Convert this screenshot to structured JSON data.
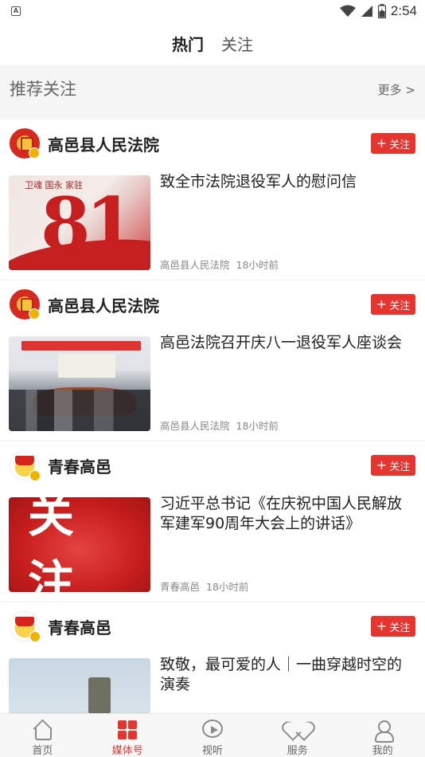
{
  "status_bar": {
    "time": "2:54",
    "notification_badge": "A"
  },
  "top_tabs": [
    {
      "label": "热门",
      "active": true
    },
    {
      "label": "关注",
      "active": false
    }
  ],
  "recommend": {
    "title": "推荐关注",
    "more": "更多 >"
  },
  "follow_label": "关注",
  "feed": [
    {
      "channel": "高邑县人民法院",
      "avatar": "court-emblem",
      "title": "致全市法院退役军人的慰问信",
      "source": "高邑县人民法院",
      "time": "18小时前",
      "thumb": "army-day-81",
      "thumb_text": "卫魂 国永 家驻"
    },
    {
      "channel": "高邑县人民法院",
      "avatar": "court-emblem",
      "title": "高邑法院召开庆八一退役军人座谈会",
      "source": "高邑县人民法院",
      "time": "18小时前",
      "thumb": "meeting-photo"
    },
    {
      "channel": "青春高邑",
      "avatar": "youth-league-emblem",
      "title": "习近平总书记《在庆祝中国人民解放军建军90周年大会上的讲话》",
      "source": "青春高邑",
      "time": "18小时前",
      "thumb": "guanzhu-banner",
      "thumb_text": "关注"
    },
    {
      "channel": "青春高邑",
      "avatar": "youth-league-emblem",
      "title": "致敬，最可爱的人｜一曲穿越时空的演奏",
      "thumb": "outdoor-photo"
    }
  ],
  "bottom_nav": [
    {
      "label": "首页",
      "icon": "home-icon",
      "active": false
    },
    {
      "label": "媒体号",
      "icon": "media-grid-icon",
      "active": true
    },
    {
      "label": "视听",
      "icon": "play-icon",
      "active": false
    },
    {
      "label": "服务",
      "icon": "heart-icon",
      "active": false
    },
    {
      "label": "我的",
      "icon": "user-icon",
      "active": false
    }
  ],
  "colors": {
    "accent": "#e8342f",
    "badge": "#f0b400"
  }
}
